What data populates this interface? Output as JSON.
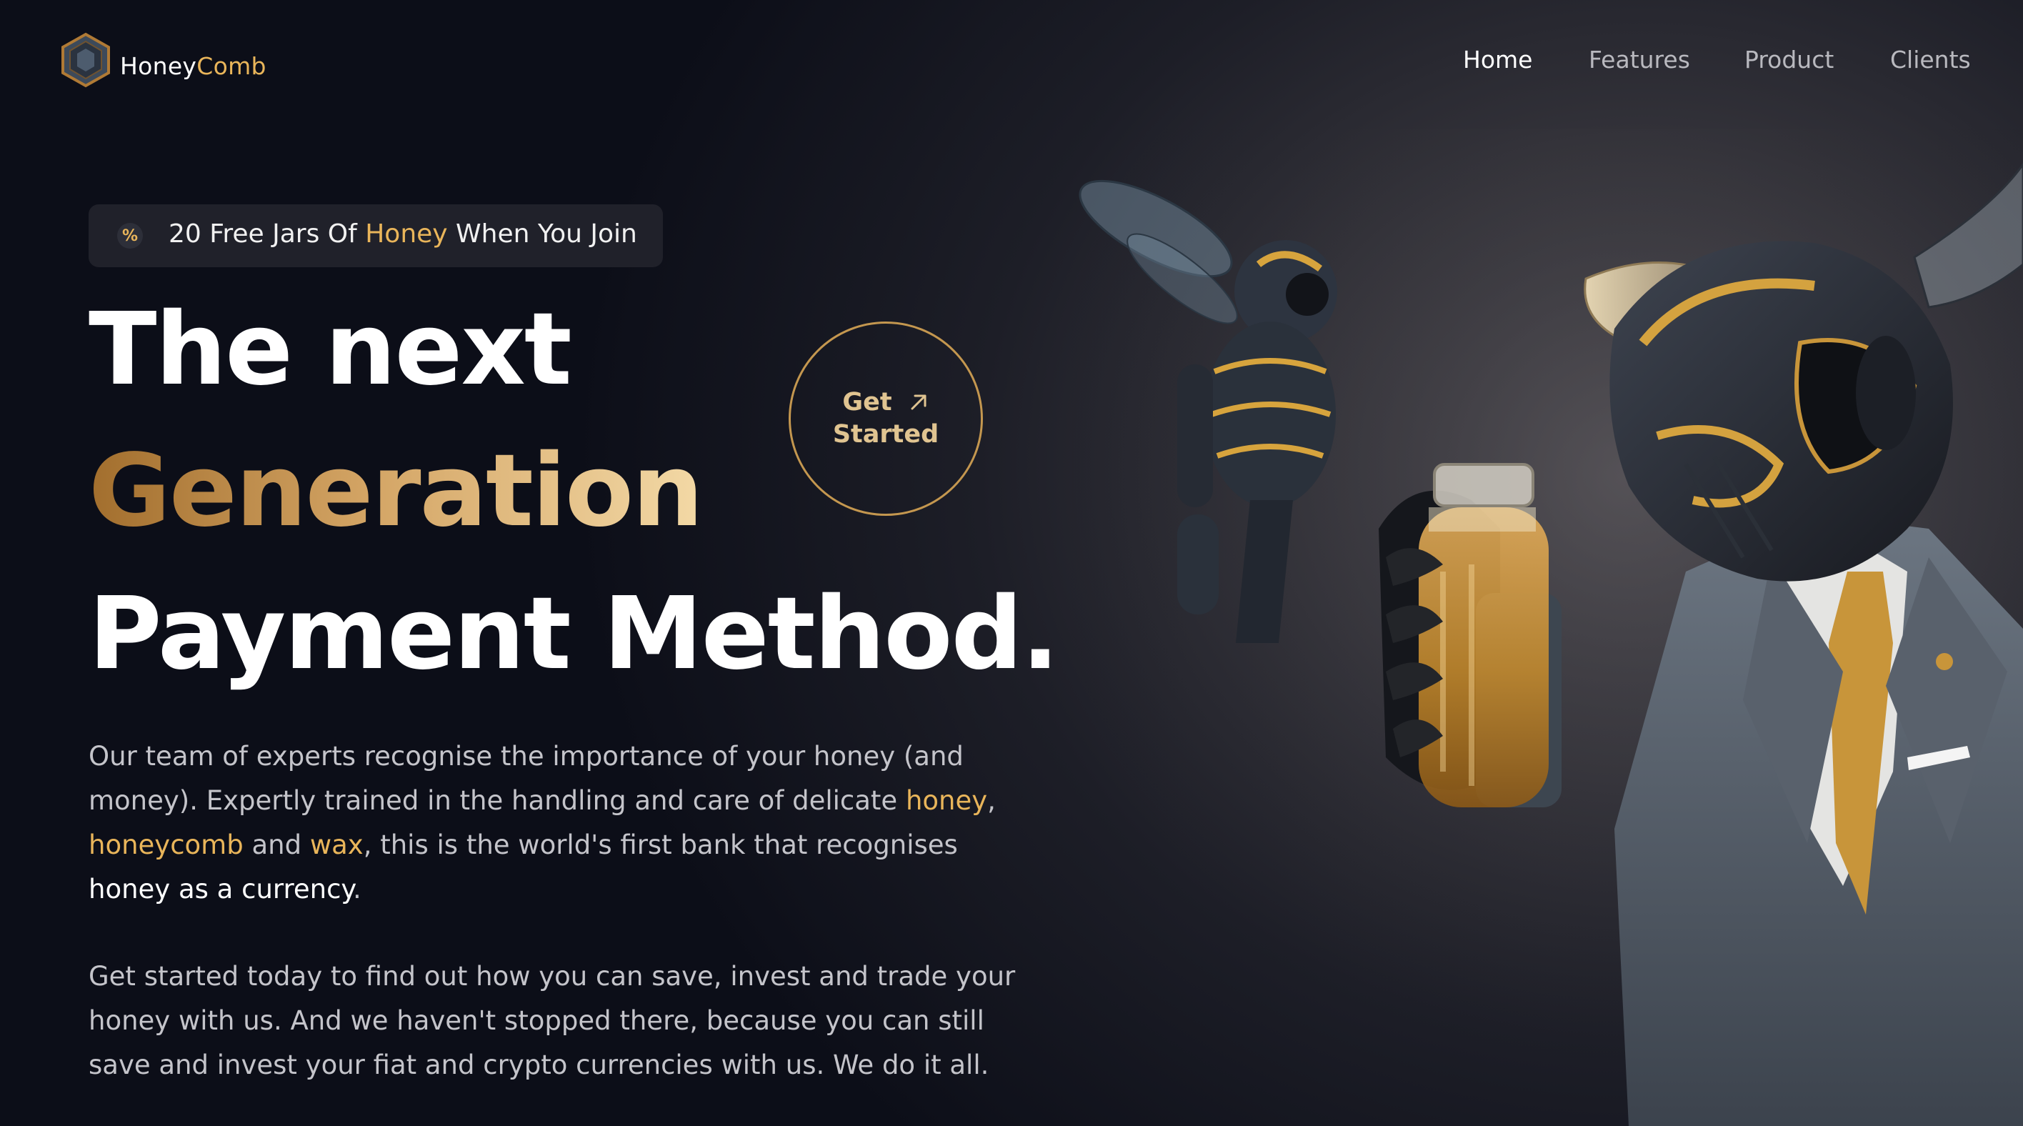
{
  "brand": {
    "name_part1": "Honey",
    "name_part2": "Comb"
  },
  "nav": {
    "items": [
      {
        "label": "Home",
        "active": true
      },
      {
        "label": "Features",
        "active": false
      },
      {
        "label": "Product",
        "active": false
      },
      {
        "label": "Clients",
        "active": false
      }
    ]
  },
  "promo": {
    "icon": "percent-icon",
    "text_before": "20 Free Jars Of ",
    "text_highlight": "Honey",
    "text_after": " When You Join"
  },
  "hero": {
    "line1": "The next",
    "line2": "Generation",
    "line3": "Payment Method."
  },
  "cta": {
    "label_line1": "Get",
    "label_line2": "Started",
    "icon": "arrow-up-right-icon"
  },
  "body": {
    "p1": {
      "t1": "Our team of experts recognise the importance of your honey (and money). Expertly trained in the handling and care of delicate ",
      "honey": "honey",
      "t2": ", ",
      "honeycomb": "honeycomb",
      "t3": " and ",
      "wax": "wax",
      "t4": ", this is the world's first bank that recognises ",
      "currency": "honey as a currency",
      "t5": "."
    },
    "p2": "Get started today to find out how you can save, invest and trade your honey with us. And we haven't stopped there, because you can still save and invest your fiat and crypto currencies with us. We do it all."
  },
  "colors": {
    "accent_gold": "#e9b55a",
    "background_dark": "#0c0e18",
    "text_muted": "#c4c4ca"
  }
}
